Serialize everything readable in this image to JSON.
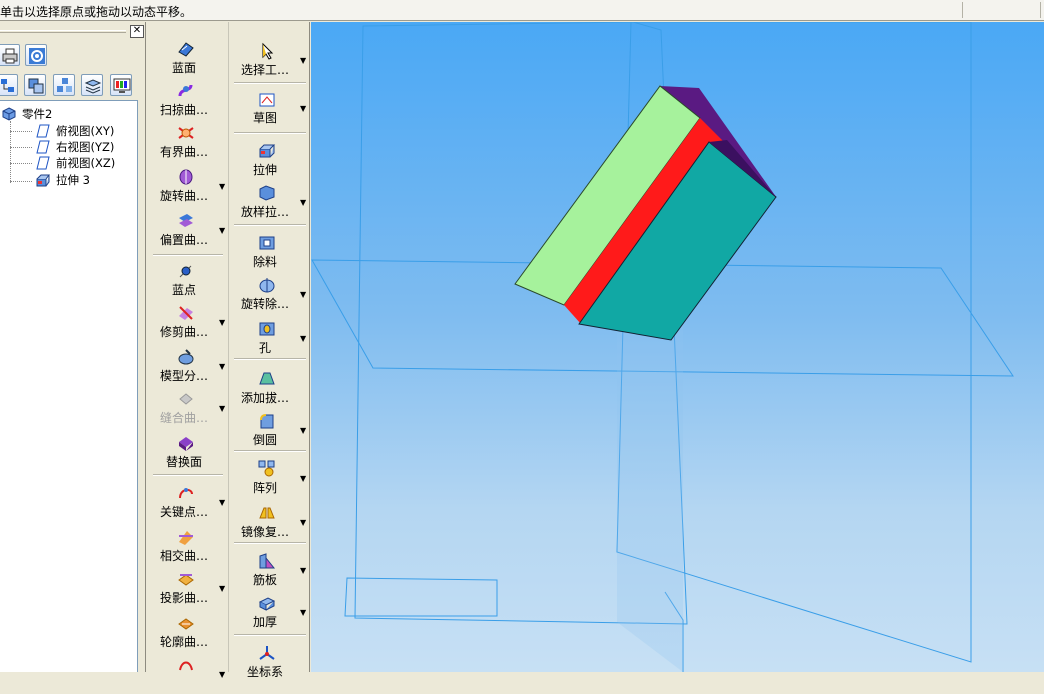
{
  "status": {
    "message": "单击以选择原点或拖动以动态平移。"
  },
  "icons": {
    "panel_top": [
      "printer-icon",
      "gear-settings-icon"
    ],
    "panel_tabs": [
      "feature-tree-icon",
      "layers-icon",
      "parts-icon",
      "stack-icon",
      "display-icon"
    ],
    "close": "close-icon"
  },
  "tree": {
    "root": "零件2",
    "items": [
      "俯视图(XY)",
      "右视图(YZ)",
      "前视图(XZ)",
      "拉伸 3"
    ]
  },
  "toolbar_surface": {
    "tools": [
      {
        "label": "蓝面",
        "icon": "blue-surface-icon",
        "dropdown": false,
        "enabled": true
      },
      {
        "label": "扫掠曲…",
        "icon": "sweep-surface-icon",
        "dropdown": false,
        "enabled": true
      },
      {
        "label": "有界曲…",
        "icon": "bounded-surface-icon",
        "dropdown": false,
        "enabled": true
      },
      {
        "label": "旋转曲…",
        "icon": "revolve-surface-icon",
        "dropdown": true,
        "enabled": true
      },
      {
        "label": "偏置曲…",
        "icon": "offset-surface-icon",
        "dropdown": true,
        "enabled": true
      },
      {
        "label": "蓝点",
        "icon": "blue-point-icon",
        "dropdown": false,
        "enabled": true
      },
      {
        "label": "修剪曲…",
        "icon": "trim-surface-icon",
        "dropdown": true,
        "enabled": true
      },
      {
        "label": "模型分…",
        "icon": "model-split-icon",
        "dropdown": true,
        "enabled": true
      },
      {
        "label": "缝合曲…",
        "icon": "stitch-surface-icon",
        "dropdown": true,
        "enabled": false
      },
      {
        "label": "替换面",
        "icon": "replace-face-icon",
        "dropdown": false,
        "enabled": true
      },
      {
        "label": "关键点…",
        "icon": "key-point-icon",
        "dropdown": true,
        "enabled": true
      },
      {
        "label": "相交曲…",
        "icon": "intersect-curve-icon",
        "dropdown": false,
        "enabled": true
      },
      {
        "label": "投影曲…",
        "icon": "project-curve-icon",
        "dropdown": true,
        "enabled": true
      },
      {
        "label": "轮廓曲…",
        "icon": "contour-curve-icon",
        "dropdown": false,
        "enabled": true
      }
    ]
  },
  "toolbar_feature": {
    "tools": [
      {
        "label": "选择工…",
        "icon": "select-tool-icon",
        "dropdown": true
      },
      {
        "label": "草图",
        "icon": "sketch-icon",
        "dropdown": true
      },
      {
        "label": "拉伸",
        "icon": "extrude-icon",
        "dropdown": false
      },
      {
        "label": "放样拉…",
        "icon": "loft-icon",
        "dropdown": true
      },
      {
        "label": "除料",
        "icon": "cut-icon",
        "dropdown": false
      },
      {
        "label": "旋转除…",
        "icon": "revolve-cut-icon",
        "dropdown": true
      },
      {
        "label": "孔",
        "icon": "hole-icon",
        "dropdown": true
      },
      {
        "label": "添加拔…",
        "icon": "draft-icon",
        "dropdown": false
      },
      {
        "label": "倒圆",
        "icon": "fillet-icon",
        "dropdown": true
      },
      {
        "label": "阵列",
        "icon": "pattern-icon",
        "dropdown": true
      },
      {
        "label": "镜像复…",
        "icon": "mirror-icon",
        "dropdown": true
      },
      {
        "label": "筋板",
        "icon": "rib-icon",
        "dropdown": true
      },
      {
        "label": "加厚",
        "icon": "thicken-icon",
        "dropdown": true
      },
      {
        "label": "坐标系",
        "icon": "coordinate-system-icon",
        "dropdown": false
      }
    ]
  },
  "viewport": {
    "colors": {
      "sky_top": "#4aa8f5",
      "sky_bottom": "#c7e0f4",
      "plane_edges": "#3a9ee8",
      "face_light_green": "#a6f29c",
      "face_red": "#ff1a1a",
      "face_teal": "#11a8a4",
      "face_purple": "#5a1a82"
    }
  }
}
